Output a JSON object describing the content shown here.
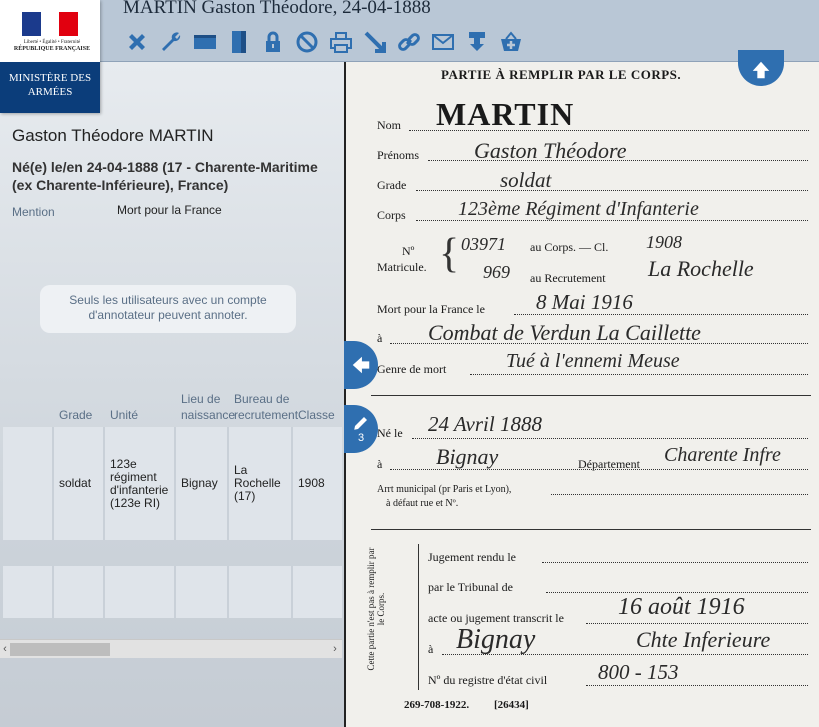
{
  "header": {
    "title": "MARTIN Gaston Théodore, 24-04-1888",
    "logo_line1": "Liberté • Égalité • Fraternité",
    "logo_line2": "RÉPUBLIQUE FRANÇAISE",
    "ministry": "MINISTÈRE DES ARMÉES",
    "toolbar": [
      "close-icon",
      "wrench-icon",
      "fit-width-icon",
      "fit-height-icon",
      "lock-icon",
      "block-icon",
      "print-icon",
      "expand-icon",
      "link-icon",
      "mail-icon",
      "download-icon",
      "basket-icon"
    ]
  },
  "colors": {
    "header_bg": "#b9c7d6",
    "accent": "#2f6fb0",
    "ministry_bg": "#0b3d7a"
  },
  "person": {
    "name": "Gaston Théodore MARTIN",
    "birth": "Né(e) le/en 24-04-1888 (17 - Charente-Maritime (ex Charente-Inférieure), France)",
    "mention_label": "Mention",
    "mention_value": "Mort pour la France"
  },
  "notice": "Seuls les utilisateurs avec un compte d'annotateur peuvent annoter.",
  "table": {
    "headers": [
      "",
      "Grade",
      "Unité",
      "Lieu de naissance",
      "Bureau de recrutement",
      "Classe"
    ],
    "row": [
      "",
      "soldat",
      "123e régiment d'infanterie (123e RI)",
      "Bignay",
      "La Rochelle (17)",
      "1908"
    ]
  },
  "side": {
    "annotation_count": "3"
  },
  "document": {
    "heading": "PARTIE À REMPLIR PAR LE CORPS.",
    "nom_label": "Nom",
    "nom": "MARTIN",
    "prenoms_label": "Prénoms",
    "prenoms": "Gaston Théodore",
    "grade_label": "Grade",
    "grade": "soldat",
    "corps_label": "Corps",
    "corps": "123ème Régiment d'Infanterie",
    "no_label": "Nº",
    "matricule_label": "Matricule.",
    "au_corps": "au Corps. — Cl.",
    "matricule_corps": "03971",
    "classe": "1908",
    "au_recrutement": "au Recrutement",
    "matricule_rec": "969",
    "recrutement": "La Rochelle",
    "mort_label": "Mort pour la France le",
    "mort_date": "8 Mai 1916",
    "a_label": "à",
    "mort_lieu": "Combat de Verdun La Caillette",
    "genre_label": "Genre de mort",
    "genre": "Tué à l'ennemi Meuse",
    "ne_label": "Né le",
    "ne_date": "24 Avril 1888",
    "ne_lieu": "Bignay",
    "dept_label": "Département",
    "dept": "Charente Infre",
    "arr_label": "Arrt municipal (pr Paris et Lyon),",
    "arr_label2": "à défaut rue et Nº.",
    "side_note": "Cette partie n'est pas à remplir par le Corps.",
    "jug_label": "Jugement rendu le",
    "trib_label": "par le Tribunal de",
    "acte_label": "acte ou jugement transcrit le",
    "acte_date": "16 août 1916",
    "acte_lieu": "Bignay",
    "acte_dept": "Chte Inferieure",
    "registre_label": "Nº du registre d'état civil",
    "registre": "800 - 153",
    "footer": "269-708-1922.",
    "footer2": "[26434]"
  }
}
